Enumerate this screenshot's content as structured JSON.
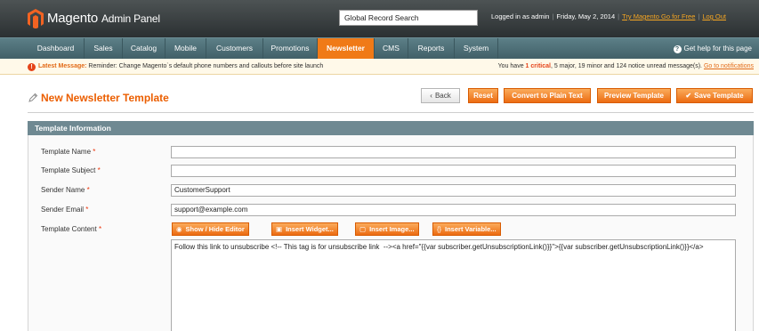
{
  "header": {
    "brand": "Magento",
    "brand_sub": "Admin Panel",
    "search_value": "Global Record Search",
    "logged_in": "Logged in as admin",
    "date": "Friday, May 2, 2014",
    "try_go": "Try Magento Go for Free",
    "logout": "Log Out"
  },
  "nav": {
    "items": [
      "Dashboard",
      "Sales",
      "Catalog",
      "Mobile",
      "Customers",
      "Promotions",
      "Newsletter",
      "CMS",
      "Reports",
      "System"
    ],
    "active": "Newsletter",
    "help": "Get help for this page"
  },
  "message": {
    "label": "Latest Message:",
    "text": "Reminder: Change Magento`s default phone numbers and callouts before site launch",
    "right_pre": "You have ",
    "critical": "1 critical",
    "right_post": ", 5 major, 19 minor and 124 notice unread message(s).",
    "link": "Go to notifications"
  },
  "page": {
    "title": "New Newsletter Template",
    "buttons": {
      "back": "Back",
      "reset": "Reset",
      "convert": "Convert to Plain Text",
      "preview": "Preview Template",
      "save": "Save Template"
    }
  },
  "form": {
    "section_title": "Template Information",
    "fields": {
      "name_label": "Template Name",
      "name_value": "",
      "subject_label": "Template Subject",
      "subject_value": "",
      "sender_name_label": "Sender Name",
      "sender_name_value": "CustomerSupport",
      "sender_email_label": "Sender Email",
      "sender_email_value": "support@example.com",
      "content_label": "Template Content",
      "required_mark": "*"
    },
    "editor_buttons": {
      "toggle": "Show / Hide Editor",
      "widget": "Insert Widget...",
      "image": "Insert Image...",
      "variable": "Insert Variable..."
    },
    "content": "Follow this link to unsubscribe <!-- This tag is for unsubscribe link  --><a href=\"{{var subscriber.getUnsubscriptionLink()}}\">{{var subscriber.getUnsubscriptionLink()}}</a>"
  },
  "colors": {
    "accent": "#eb5e00",
    "nav_bg": "#4e6f77",
    "header_bg": "#2b3032"
  }
}
